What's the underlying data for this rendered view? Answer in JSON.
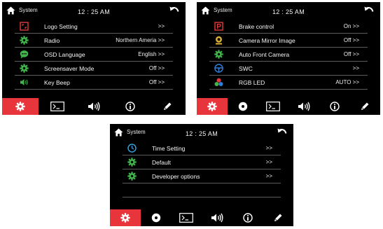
{
  "screens": [
    {
      "header": {
        "title": "System",
        "time": "12 : 25  AM"
      },
      "rows": [
        {
          "label": "Logo Setting",
          "value": ">>",
          "icon": "logo-setting-icon"
        },
        {
          "label": "Radio",
          "value": "Northern Ameria >>",
          "icon": "gear-icon"
        },
        {
          "label": "OSD Language",
          "value": "English >>",
          "icon": "chat-bubble-icon"
        },
        {
          "label": "Screensaver Mode",
          "value": "Off >>",
          "icon": "gear-icon"
        },
        {
          "label": "Key Beep",
          "value": "Off >>",
          "icon": "speaker-icon"
        }
      ]
    },
    {
      "header": {
        "title": "System",
        "time": "12 : 25  AM"
      },
      "rows": [
        {
          "label": "Brake control",
          "value": "On >>",
          "icon": "parking-p-icon"
        },
        {
          "label": "Camera Mirror Image",
          "value": "Off >>",
          "icon": "camera-icon"
        },
        {
          "label": "Auto Front Camera",
          "value": "Off >>",
          "icon": "gear-icon"
        },
        {
          "label": "SWC",
          "value": ">>",
          "icon": "steering-wheel-icon"
        },
        {
          "label": "RGB LED",
          "value": "AUTO >>",
          "icon": "rgb-dots-icon"
        }
      ]
    },
    {
      "header": {
        "title": "System",
        "time": "12 : 25  AM"
      },
      "rows": [
        {
          "label": "Time Setting",
          "value": ">>",
          "icon": "clock-icon"
        },
        {
          "label": "Default",
          "value": ">>",
          "icon": "gear-icon"
        },
        {
          "label": "Developer options",
          "value": ">>",
          "icon": "gear-icon"
        }
      ]
    }
  ],
  "colors": {
    "background": "#000000",
    "active_tab": "#e8343b",
    "divider": "#5c5c5c",
    "gear_green": "#3fb54a",
    "clock_blue": "#2e9fdc",
    "warning_red": "#e23b3b",
    "camera_yellow": "#d9b034"
  }
}
